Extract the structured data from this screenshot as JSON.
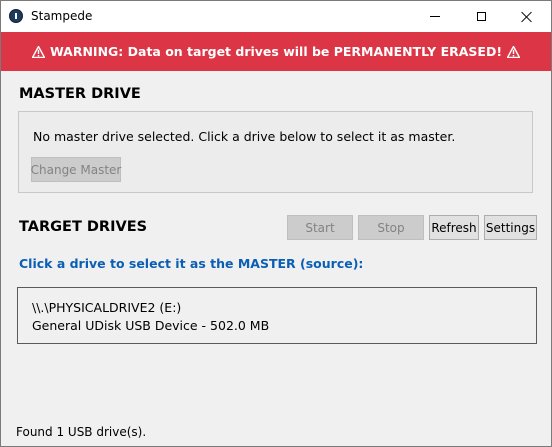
{
  "window": {
    "title": "Stampede",
    "app_icon": "stampede-app-icon",
    "controls": [
      "minimize-icon",
      "maximize-icon",
      "close-icon"
    ]
  },
  "warning": {
    "text": "WARNING: Data on target drives will be PERMANENTLY ERASED!",
    "icon": "warning-triangle-icon",
    "background": "#dc3545",
    "color": "#ffffff"
  },
  "master": {
    "heading": "MASTER DRIVE",
    "status_text": "No master drive selected. Click a drive below to select it as master.",
    "change_button": {
      "label": "Change Master",
      "enabled": false
    }
  },
  "targets": {
    "heading": "TARGET DRIVES",
    "buttons": {
      "start": {
        "label": "Start",
        "enabled": false
      },
      "stop": {
        "label": "Stop",
        "enabled": false
      },
      "refresh": {
        "label": "Refresh",
        "enabled": true
      },
      "settings": {
        "label": "Settings",
        "enabled": true
      }
    },
    "instruction": "Click a drive to select it as the MASTER (source):",
    "instruction_color": "#0a5fb4",
    "drives": [
      {
        "path": "\\\\.\\PHYSICALDRIVE2 (E:)",
        "description": "General UDisk USB Device - 502.0 MB"
      }
    ]
  },
  "status_bar": {
    "text": "Found 1 USB drive(s)."
  }
}
